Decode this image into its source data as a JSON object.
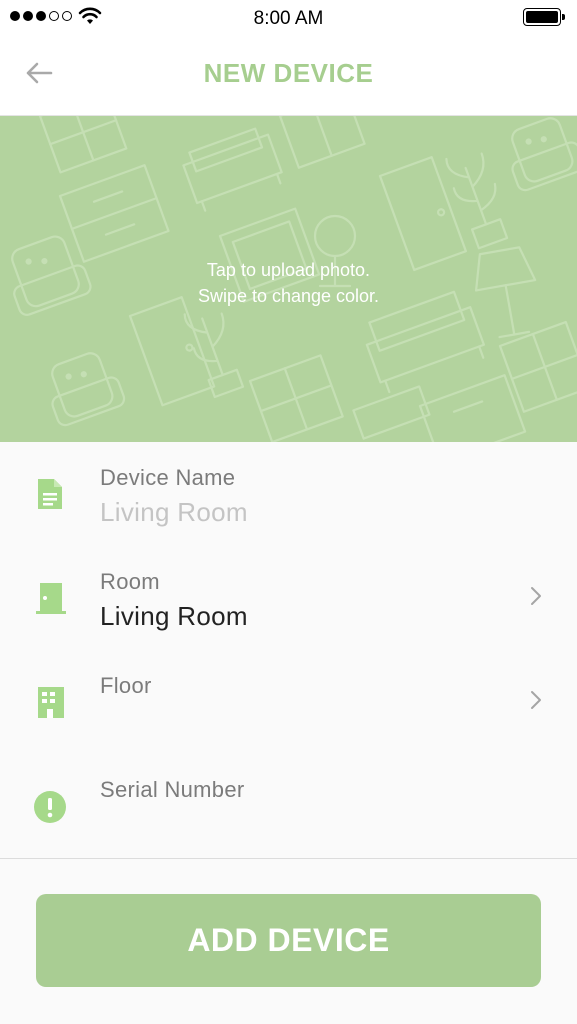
{
  "status_bar": {
    "time": "8:00 AM"
  },
  "nav": {
    "title": "NEW DEVICE",
    "back_icon": "arrow-left-icon"
  },
  "photo": {
    "hint_line1": "Tap to upload photo.",
    "hint_line2": "Swipe to change color.",
    "background_color": "#b3d39e"
  },
  "form": {
    "device_name": {
      "label": "Device Name",
      "placeholder": "Living Room",
      "icon": "document-icon"
    },
    "room": {
      "label": "Room",
      "value": "Living Room",
      "icon": "door-icon"
    },
    "floor": {
      "label": "Floor",
      "value": "",
      "icon": "building-icon"
    },
    "serial": {
      "label": "Serial Number",
      "value": "",
      "icon": "alert-circle-icon"
    }
  },
  "actions": {
    "add_label": "ADD DEVICE"
  },
  "colors": {
    "accent": "#a6ce8f",
    "button": "#a9cd93",
    "icon": "#a6d98a"
  }
}
